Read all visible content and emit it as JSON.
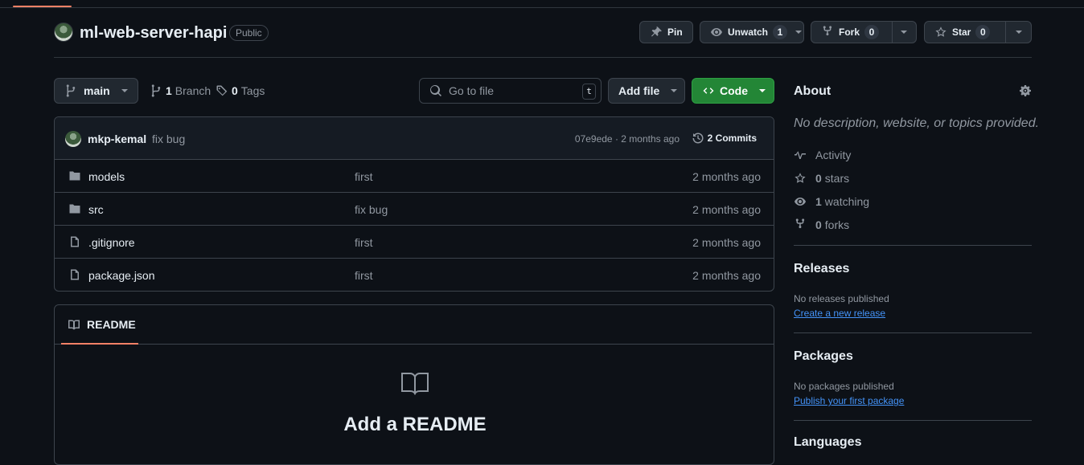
{
  "repo": {
    "name": "ml-web-server-hapi",
    "visibility": "Public",
    "actions": {
      "pin": "Pin",
      "unwatch": "Unwatch",
      "unwatch_count": "1",
      "fork": "Fork",
      "fork_count": "0",
      "star": "Star",
      "star_count": "0"
    }
  },
  "toolbar": {
    "branch": "main",
    "branch_count": "1",
    "branch_label": "Branch",
    "tag_count": "0",
    "tag_label": "Tags",
    "goto_placeholder": "Go to file",
    "goto_kbd": "t",
    "add_file": "Add file",
    "code": "Code"
  },
  "latest_commit": {
    "author": "mkp-kemal",
    "message": "fix bug",
    "sha_time": "07e9ede · 2 months ago",
    "commits": "2 Commits"
  },
  "files": [
    {
      "type": "folder",
      "name": "models",
      "message": "first",
      "date": "2 months ago"
    },
    {
      "type": "folder",
      "name": "src",
      "message": "fix bug",
      "date": "2 months ago"
    },
    {
      "type": "file",
      "name": ".gitignore",
      "message": "first",
      "date": "2 months ago"
    },
    {
      "type": "file",
      "name": "package.json",
      "message": "first",
      "date": "2 months ago"
    }
  ],
  "readme": {
    "tab": "README",
    "title": "Add a README"
  },
  "about": {
    "title": "About",
    "description": "No description, website, or topics provided.",
    "activity": "Activity",
    "stars_count": "0",
    "stars_label": "stars",
    "watching_count": "1",
    "watching_label": "watching",
    "forks_count": "0",
    "forks_label": "forks"
  },
  "releases": {
    "title": "Releases",
    "note": "No releases published",
    "link": "Create a new release"
  },
  "packages": {
    "title": "Packages",
    "note": "No packages published",
    "link": "Publish your first package"
  },
  "languages": {
    "title": "Languages"
  }
}
